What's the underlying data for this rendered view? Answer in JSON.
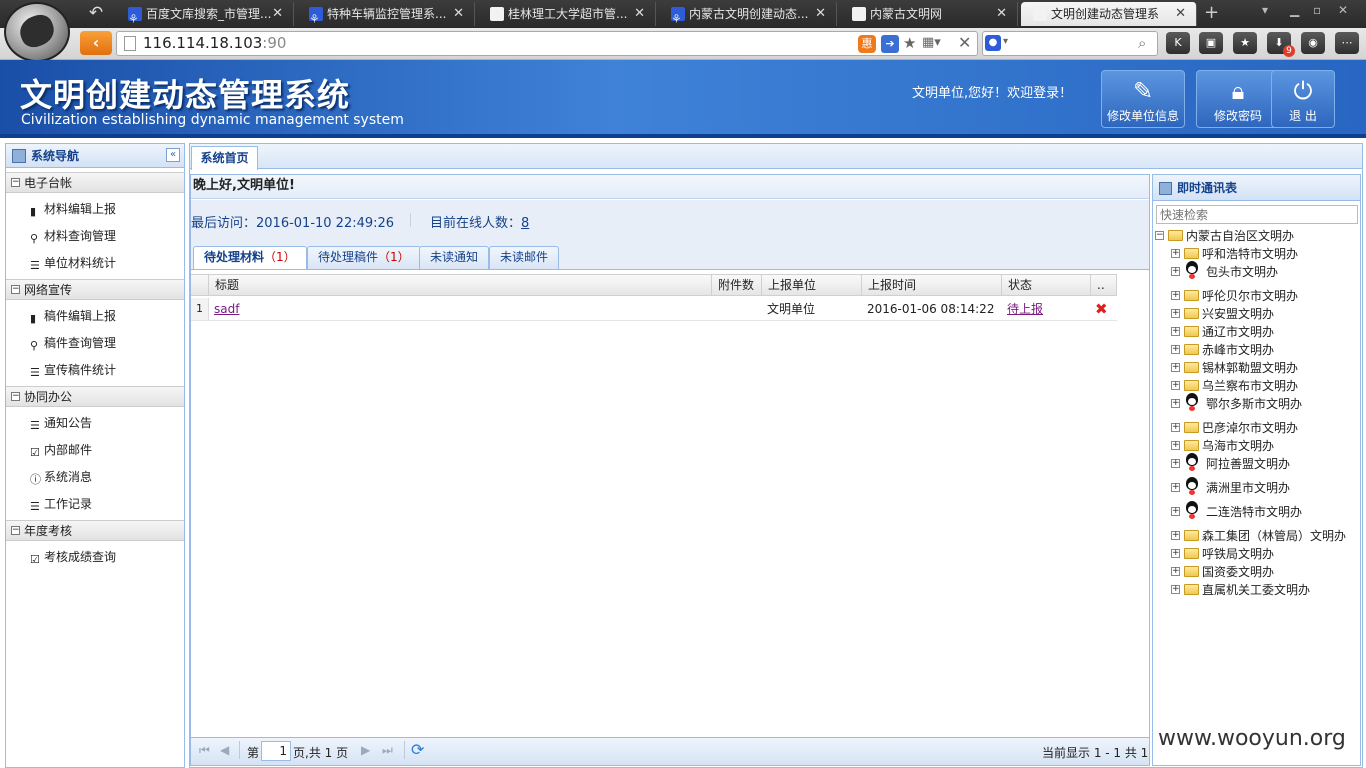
{
  "browser": {
    "tabs": [
      {
        "label": "百度文库搜索_市管理...",
        "icon": "paw"
      },
      {
        "label": "特种车辆监控管理系...",
        "icon": "paw"
      },
      {
        "label": "桂林理工大学超市管...",
        "icon": "doc"
      },
      {
        "label": "内蒙古文明创建动态...",
        "icon": "paw"
      },
      {
        "label": "内蒙古文明网",
        "icon": "doc"
      },
      {
        "label": "文明创建动态管理系",
        "icon": "doc"
      }
    ],
    "url_host": "116.114.18.103",
    "url_port": ":90",
    "download_badge": "9"
  },
  "header": {
    "title": "文明创建动态管理系统",
    "subtitle": "Civilization establishing dynamic management system",
    "welcome": "文明单位,您好！欢迎登录！",
    "buttons": {
      "edit_info": "修改单位信息",
      "change_pwd": "修改密码",
      "logout": "退 出"
    }
  },
  "nav": {
    "title": "系统导航",
    "groups": [
      {
        "label": "电子台帐",
        "items": [
          "材料编辑上报",
          "材料查询管理",
          "单位材料统计"
        ]
      },
      {
        "label": "网络宣传",
        "items": [
          "稿件编辑上报",
          "稿件查询管理",
          "宣传稿件统计"
        ]
      },
      {
        "label": "协同办公",
        "items": [
          "通知公告",
          "内部邮件",
          "系统消息",
          "工作记录"
        ]
      },
      {
        "label": "年度考核",
        "items": [
          "考核成绩查询"
        ]
      }
    ]
  },
  "main": {
    "home_tab": "系统首页",
    "greeting": "晚上好,文明单位!",
    "last_visit": "最后访问：2016-01-10 22:49:26",
    "online_label": "目前在线人数：",
    "online_count": "8",
    "subtabs": [
      {
        "label": "待处理材料",
        "count": "（1）"
      },
      {
        "label": "待处理稿件",
        "count": "（1）"
      },
      {
        "label": "未读通知",
        "count": ""
      },
      {
        "label": "未读邮件",
        "count": ""
      }
    ],
    "grid": {
      "columns": [
        "标题",
        "附件数",
        "上报单位",
        "上报时间",
        "状态",
        ".."
      ],
      "rows": [
        {
          "num": "1",
          "title": "sadf",
          "attachments": "",
          "unit": "文明单位",
          "time": "2016-01-06 08:14:22",
          "status": "待上报"
        }
      ]
    },
    "pager": {
      "page_prefix": "第",
      "page": "1",
      "page_suffix": "页,共 1 页",
      "display": "当前显示 1 - 1 共 1"
    }
  },
  "contacts": {
    "title": "即时通讯表",
    "search_placeholder": "快速检索",
    "root": "内蒙古自治区文明办",
    "items": [
      {
        "label": "呼和浩特市文明办",
        "icon": "folder"
      },
      {
        "label": "包头市文明办",
        "icon": "qq"
      },
      {
        "label": "呼伦贝尔市文明办",
        "icon": "folder"
      },
      {
        "label": "兴安盟文明办",
        "icon": "folder"
      },
      {
        "label": "通辽市文明办",
        "icon": "folder"
      },
      {
        "label": "赤峰市文明办",
        "icon": "folder"
      },
      {
        "label": "锡林郭勒盟文明办",
        "icon": "folder"
      },
      {
        "label": "乌兰察布市文明办",
        "icon": "folder"
      },
      {
        "label": "鄂尔多斯市文明办",
        "icon": "qq"
      },
      {
        "label": "巴彦淖尔市文明办",
        "icon": "folder"
      },
      {
        "label": "乌海市文明办",
        "icon": "folder"
      },
      {
        "label": "阿拉善盟文明办",
        "icon": "qq"
      },
      {
        "label": "满洲里市文明办",
        "icon": "qq"
      },
      {
        "label": "二连浩特市文明办",
        "icon": "qq"
      },
      {
        "label": "森工集团（林管局）文明办",
        "icon": "folder"
      },
      {
        "label": "呼铁局文明办",
        "icon": "folder"
      },
      {
        "label": "国资委文明办",
        "icon": "folder"
      },
      {
        "label": "直属机关工委文明办",
        "icon": "folder"
      }
    ]
  },
  "watermark": "www.wooyun.org"
}
